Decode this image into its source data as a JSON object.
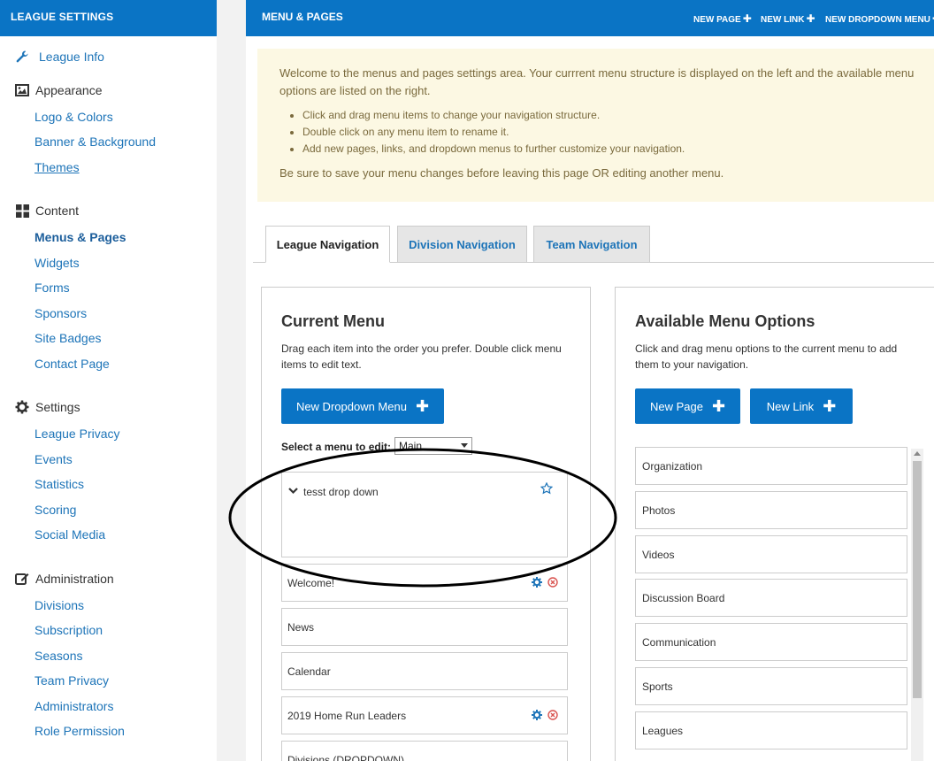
{
  "sidebar": {
    "title": "LEAGUE SETTINGS",
    "league_info": "League Info",
    "appearance": {
      "heading": "Appearance",
      "items": [
        "Logo & Colors",
        "Banner & Background",
        "Themes"
      ]
    },
    "content": {
      "heading": "Content",
      "items": [
        "Menus & Pages",
        "Widgets",
        "Forms",
        "Sponsors",
        "Site Badges",
        "Contact Page"
      ]
    },
    "settings": {
      "heading": "Settings",
      "items": [
        "League Privacy",
        "Events",
        "Statistics",
        "Scoring",
        "Social Media"
      ]
    },
    "administration": {
      "heading": "Administration",
      "items": [
        "Divisions",
        "Subscription",
        "Seasons",
        "Team Privacy",
        "Administrators",
        "Role Permission"
      ]
    }
  },
  "header": {
    "title": "MENU & PAGES",
    "new_page": "NEW PAGE",
    "new_link": "NEW LINK",
    "new_dropdown": "NEW DROPDOWN MENU"
  },
  "notice": {
    "intro": "Welcome to the menus and pages settings area. Your currrent menu structure is displayed on the left and the available menu options are listed on the right.",
    "bullets": [
      "Click and drag menu items to change your navigation structure.",
      "Double click on any menu item to rename it.",
      "Add new pages, links, and dropdown menus to further customize your navigation."
    ],
    "outro": "Be sure to save your menu changes before leaving this page OR editing another menu."
  },
  "tabs": [
    "League Navigation",
    "Division Navigation",
    "Team Navigation"
  ],
  "current_menu": {
    "title": "Current Menu",
    "desc_line1": "Drag each item into the order you prefer. Double click menu",
    "desc_line2": "items to edit text.",
    "new_dropdown_btn": "New Dropdown Menu",
    "select_label": "Select a menu to edit:",
    "select_value": "Main",
    "dropdown_item": "tesst drop down",
    "items": [
      "Welcome!",
      "News",
      "Calendar",
      "2019 Home Run Leaders",
      "Divisions (DROPDOWN)"
    ]
  },
  "available": {
    "title": "Available Menu Options",
    "desc_line1": "Click and drag menu options to the current menu to add",
    "desc_line2": "them to your navigation.",
    "new_page_btn": "New Page",
    "new_link_btn": "New Link",
    "options": [
      "Organization",
      "Photos",
      "Videos",
      "Discussion Board",
      "Communication",
      "Sports",
      "Leagues"
    ]
  },
  "colors": {
    "brand_blue": "#0a74c5",
    "link_blue": "#1d74b8",
    "notice_bg": "#fcf8e3",
    "delete_red": "#d9534f"
  }
}
